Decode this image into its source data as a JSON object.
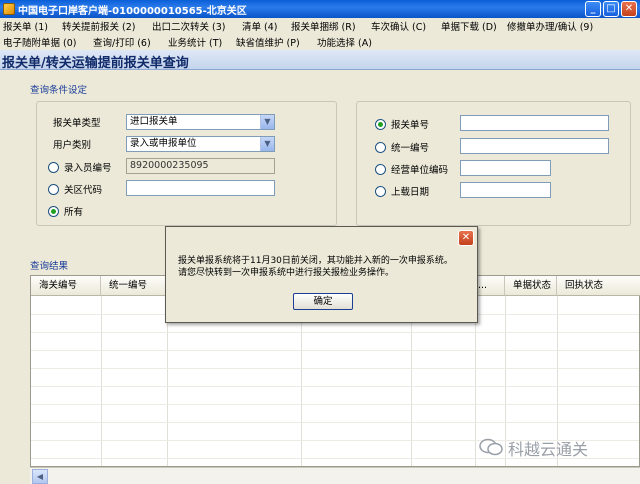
{
  "window": {
    "title": "中国电子口岸客户端-0100000010565-北京关区"
  },
  "menu": {
    "row1": [
      "报关单 (1)",
      "转关提前报关 (2)",
      "出口二次转关 (3)",
      "清单 (4)",
      "报关单捆绑 (R)",
      "车次确认 (C)",
      "单据下载 (D)",
      "修撤单办理/确认 (9)"
    ],
    "row2": [
      "电子随附单据 (0)",
      "查询/打印 (6)",
      "业务统计 (T)",
      "缺省值维护 (P)",
      "功能选择 (A)"
    ]
  },
  "page": {
    "title": "报关单/转关运输提前报关单查询"
  },
  "query": {
    "section_label": "查询条件设定",
    "left": {
      "declaration_type_label": "报关单类型",
      "declaration_type_value": "进口报关单",
      "user_category_label": "用户类别",
      "user_category_value": "录入或申报单位",
      "operator_id_label": "录入员编号",
      "operator_id_value": "8920000235095",
      "customs_code_label": "关区代码",
      "customs_code_value": "",
      "all_label": "所有"
    },
    "right": {
      "declaration_no_label": "报关单号",
      "unified_no_label": "统一编号",
      "business_unit_label": "经营单位编码",
      "upload_date_label": "上载日期"
    }
  },
  "results": {
    "section_label": "查询结果",
    "columns": [
      "海关编号",
      "统一编号",
      "...",
      "单据状态",
      "回执状态"
    ]
  },
  "dialog": {
    "line1": "报关单报系统将于11月30日前关闭，其功能并入新的一次申报系统。",
    "line2": "请您尽快转到一次申报系统中进行报关报检业务操作。",
    "ok_label": "确定"
  },
  "watermark": {
    "text": "科越云通关"
  }
}
